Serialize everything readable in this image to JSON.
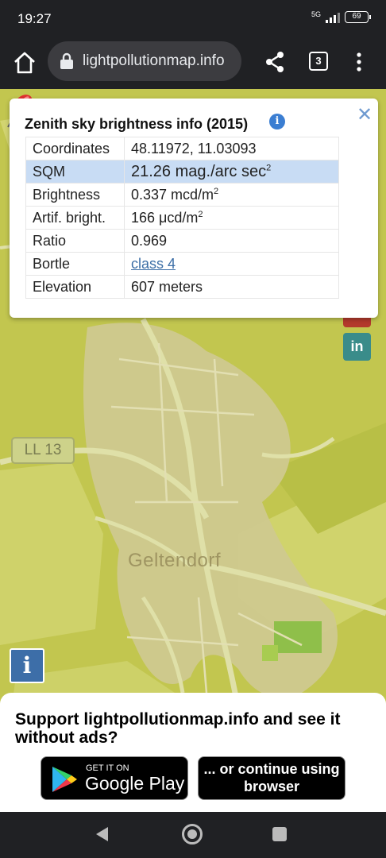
{
  "status_bar": {
    "time": "19:27",
    "network": "5G",
    "battery": "69"
  },
  "browser": {
    "url": "lightpollutionmap.info",
    "tab_count": "3"
  },
  "popup": {
    "title": "Zenith sky brightness info (2015)",
    "rows": [
      {
        "label": "Coordinates",
        "value": "48.11972, 11.03093",
        "unit_sup": ""
      },
      {
        "label": "SQM",
        "value": "21.26 mag./arc sec",
        "unit_sup": "2"
      },
      {
        "label": "Brightness",
        "value": "0.337 mcd/m",
        "unit_sup": "2"
      },
      {
        "label": "Artif. bright.",
        "value": "166 μcd/m",
        "unit_sup": "2"
      },
      {
        "label": "Ratio",
        "value": "0.969",
        "unit_sup": ""
      },
      {
        "label": "Bortle",
        "value": "class 4",
        "unit_sup": ""
      },
      {
        "label": "Elevation",
        "value": "607 meters",
        "unit_sup": ""
      }
    ],
    "highlight_row": "SQM"
  },
  "map": {
    "place_label": "Geltendorf",
    "road_label": "LL 13",
    "info_button": "i",
    "social_button": "in",
    "colors": {
      "map_bg": "#c2c64f",
      "road": "#dfe0a8",
      "built": "#cfc98f"
    }
  },
  "promo": {
    "text": "Support lightpollutionmap.info and see it without ads?",
    "google_play_small": "GET IT ON",
    "google_play_big": "Google Play",
    "browser_button": "... or continue using browser"
  },
  "icons": {
    "home": "home-icon",
    "lock": "lock-icon",
    "share": "share-icon",
    "menu": "more-vert-icon",
    "close": "close-icon",
    "pin": "map-pin-icon"
  }
}
